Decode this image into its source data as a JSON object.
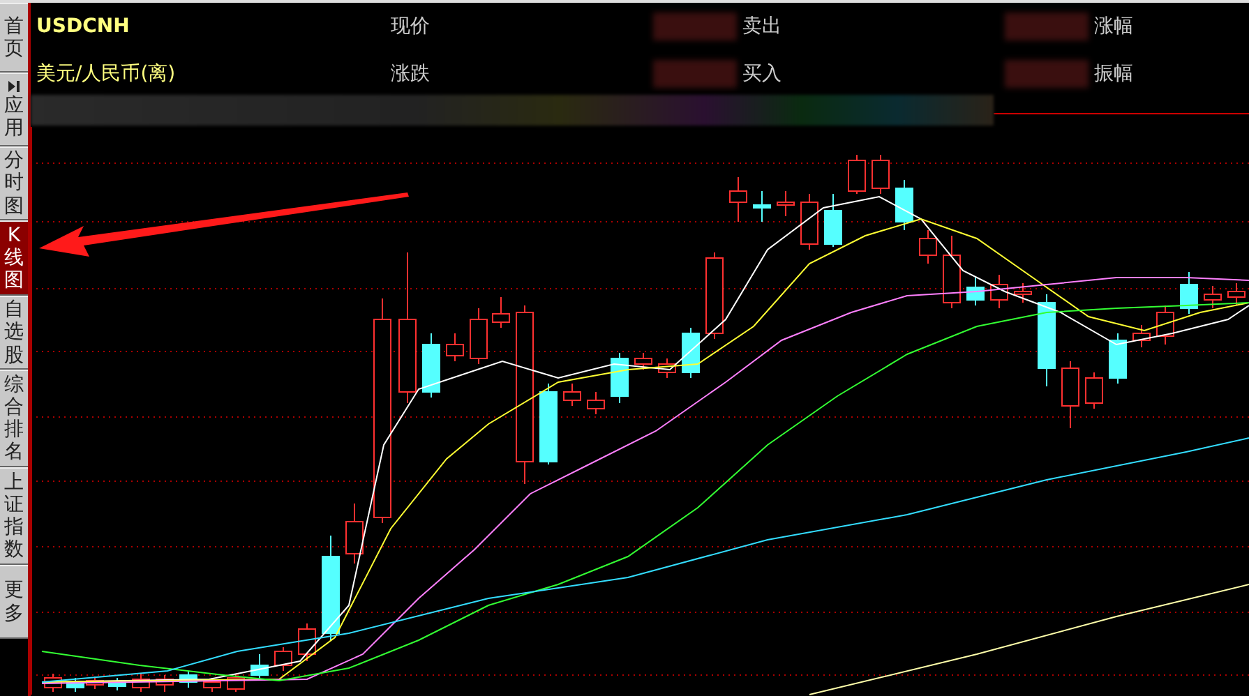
{
  "sidebar": {
    "tabs": [
      {
        "label": "首页",
        "selected": false,
        "kind": "plain"
      },
      {
        "label": "应用",
        "selected": false,
        "kind": "menu"
      },
      {
        "label": "分时图",
        "selected": false,
        "kind": "plain"
      },
      {
        "label": "K线图",
        "selected": true,
        "kind": "plain"
      },
      {
        "label": "自选股",
        "selected": false,
        "kind": "plain"
      },
      {
        "label": "综合排名",
        "selected": false,
        "kind": "plain"
      },
      {
        "label": "上证指数",
        "selected": false,
        "kind": "plain"
      },
      {
        "label": "更多",
        "selected": false,
        "kind": "plain"
      }
    ]
  },
  "quote": {
    "symbol": "USDCNH",
    "name": "美元/人民币(离)",
    "fields": [
      {
        "label": "现价"
      },
      {
        "label": "卖出"
      },
      {
        "label": "涨幅"
      },
      {
        "label": "涨跌"
      },
      {
        "label": "买入"
      },
      {
        "label": "振幅"
      }
    ]
  }
}
